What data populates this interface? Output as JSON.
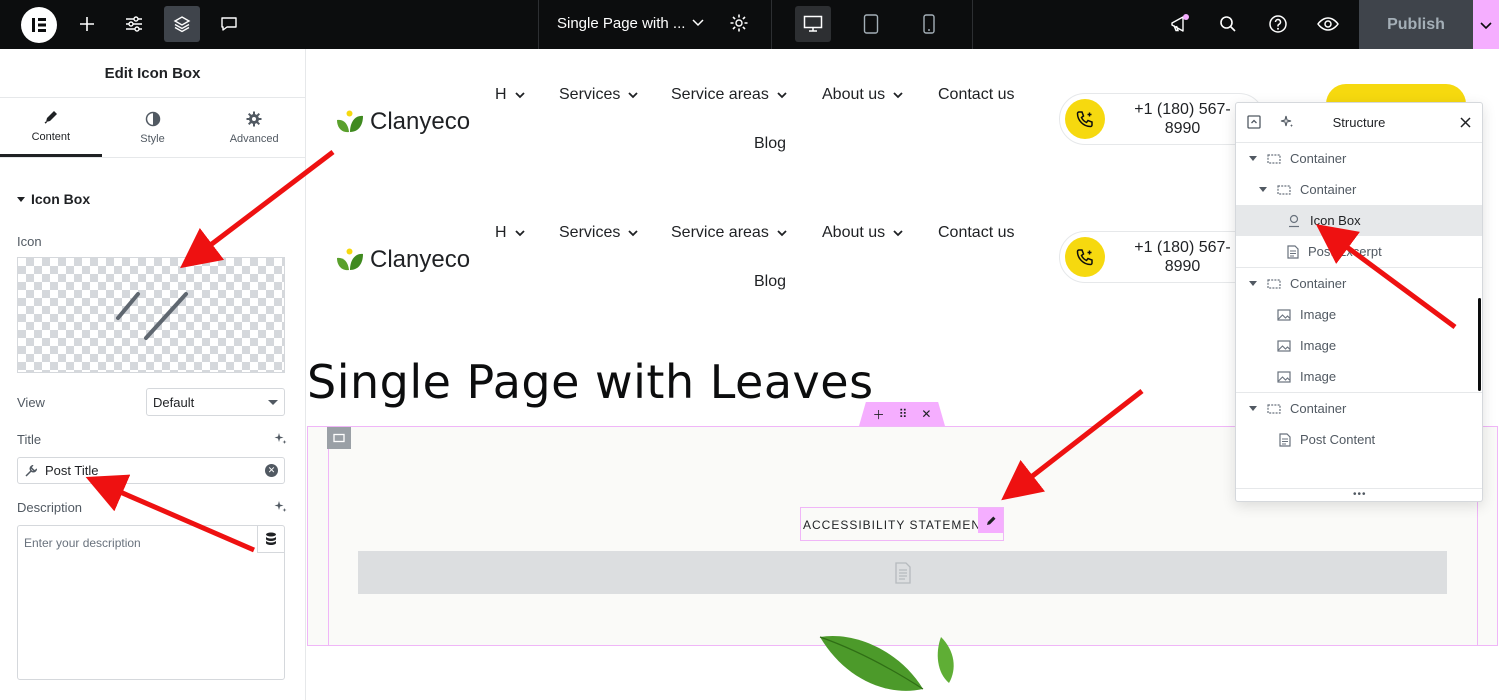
{
  "topbar": {
    "document_title": "Single Page with ...",
    "publish_label": "Publish"
  },
  "panel": {
    "header": "Edit Icon Box",
    "tabs": [
      {
        "label": "Content"
      },
      {
        "label": "Style"
      },
      {
        "label": "Advanced"
      }
    ],
    "section_title": "Icon Box",
    "icon_label": "Icon",
    "view_label": "View",
    "view_value": "Default",
    "title_label": "Title",
    "title_value": "Post Title",
    "description_label": "Description",
    "description_placeholder": "Enter your description"
  },
  "canvas": {
    "brand": "Clanyeco",
    "nav": [
      {
        "label": "H"
      },
      {
        "label": "Services"
      },
      {
        "label": "Service areas"
      },
      {
        "label": "About us"
      },
      {
        "label": "Contact us"
      },
      {
        "label": "Blog"
      }
    ],
    "phone_line1": "+1 (180) 567-",
    "phone_line2": "8990",
    "page_heading": "Single Page with Leaves",
    "icon_box_title": "ACCESSIBILITY STATEMENT"
  },
  "structure": {
    "title": "Structure",
    "items": [
      {
        "label": "Container"
      },
      {
        "label": "Container"
      },
      {
        "label": "Icon Box"
      },
      {
        "label": "Post Excerpt"
      },
      {
        "label": "Container"
      },
      {
        "label": "Image"
      },
      {
        "label": "Image"
      },
      {
        "label": "Image"
      },
      {
        "label": "Container"
      },
      {
        "label": "Post Content"
      }
    ]
  },
  "colors": {
    "topbar": "#0c0d0e",
    "accent_pink": "#f5aeff",
    "brand_yellow": "#f6d90f",
    "arrow_red": "#ee1111"
  }
}
